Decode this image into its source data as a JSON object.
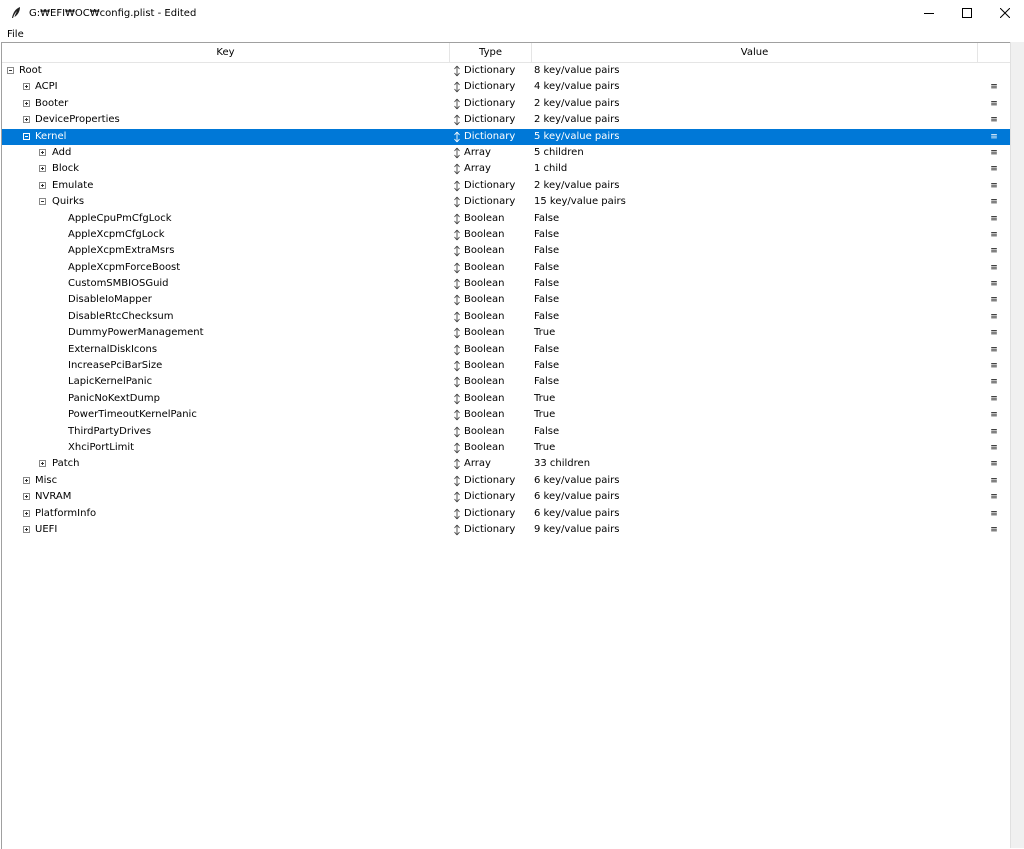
{
  "window": {
    "title": "G:₩EFI₩OC₩config.plist - Edited"
  },
  "menubar": {
    "file_label": "File"
  },
  "columns": {
    "key": "Key",
    "type": "Type",
    "value": "Value"
  },
  "icons": {
    "row_menu_glyph": "≡",
    "expand": "expand-icon",
    "collapse": "collapse-icon"
  },
  "colors": {
    "selection": "#0078d7"
  },
  "tree": [
    {
      "key": "Root",
      "type": "Dictionary",
      "value": "8 key/value pairs",
      "depth": 0,
      "toggle": "collapse",
      "selected": false,
      "menu": false
    },
    {
      "key": "ACPI",
      "type": "Dictionary",
      "value": "4 key/value pairs",
      "depth": 1,
      "toggle": "expand",
      "selected": false,
      "menu": true
    },
    {
      "key": "Booter",
      "type": "Dictionary",
      "value": "2 key/value pairs",
      "depth": 1,
      "toggle": "expand",
      "selected": false,
      "menu": true
    },
    {
      "key": "DeviceProperties",
      "type": "Dictionary",
      "value": "2 key/value pairs",
      "depth": 1,
      "toggle": "expand",
      "selected": false,
      "menu": true
    },
    {
      "key": "Kernel",
      "type": "Dictionary",
      "value": "5 key/value pairs",
      "depth": 1,
      "toggle": "collapse",
      "selected": true,
      "menu": true
    },
    {
      "key": "Add",
      "type": "Array",
      "value": "5 children",
      "depth": 2,
      "toggle": "expand",
      "selected": false,
      "menu": true
    },
    {
      "key": "Block",
      "type": "Array",
      "value": "1 child",
      "depth": 2,
      "toggle": "expand",
      "selected": false,
      "menu": true
    },
    {
      "key": "Emulate",
      "type": "Dictionary",
      "value": "2 key/value pairs",
      "depth": 2,
      "toggle": "expand",
      "selected": false,
      "menu": true
    },
    {
      "key": "Quirks",
      "type": "Dictionary",
      "value": "15 key/value pairs",
      "depth": 2,
      "toggle": "collapse",
      "selected": false,
      "menu": true
    },
    {
      "key": "AppleCpuPmCfgLock",
      "type": "Boolean",
      "value": "False",
      "depth": 3,
      "toggle": "none",
      "selected": false,
      "menu": true
    },
    {
      "key": "AppleXcpmCfgLock",
      "type": "Boolean",
      "value": "False",
      "depth": 3,
      "toggle": "none",
      "selected": false,
      "menu": true
    },
    {
      "key": "AppleXcpmExtraMsrs",
      "type": "Boolean",
      "value": "False",
      "depth": 3,
      "toggle": "none",
      "selected": false,
      "menu": true
    },
    {
      "key": "AppleXcpmForceBoost",
      "type": "Boolean",
      "value": "False",
      "depth": 3,
      "toggle": "none",
      "selected": false,
      "menu": true
    },
    {
      "key": "CustomSMBIOSGuid",
      "type": "Boolean",
      "value": "False",
      "depth": 3,
      "toggle": "none",
      "selected": false,
      "menu": true
    },
    {
      "key": "DisableIoMapper",
      "type": "Boolean",
      "value": "False",
      "depth": 3,
      "toggle": "none",
      "selected": false,
      "menu": true
    },
    {
      "key": "DisableRtcChecksum",
      "type": "Boolean",
      "value": "False",
      "depth": 3,
      "toggle": "none",
      "selected": false,
      "menu": true
    },
    {
      "key": "DummyPowerManagement",
      "type": "Boolean",
      "value": "True",
      "depth": 3,
      "toggle": "none",
      "selected": false,
      "menu": true
    },
    {
      "key": "ExternalDiskIcons",
      "type": "Boolean",
      "value": "False",
      "depth": 3,
      "toggle": "none",
      "selected": false,
      "menu": true
    },
    {
      "key": "IncreasePciBarSize",
      "type": "Boolean",
      "value": "False",
      "depth": 3,
      "toggle": "none",
      "selected": false,
      "menu": true
    },
    {
      "key": "LapicKernelPanic",
      "type": "Boolean",
      "value": "False",
      "depth": 3,
      "toggle": "none",
      "selected": false,
      "menu": true
    },
    {
      "key": "PanicNoKextDump",
      "type": "Boolean",
      "value": "True",
      "depth": 3,
      "toggle": "none",
      "selected": false,
      "menu": true
    },
    {
      "key": "PowerTimeoutKernelPanic",
      "type": "Boolean",
      "value": "True",
      "depth": 3,
      "toggle": "none",
      "selected": false,
      "menu": true
    },
    {
      "key": "ThirdPartyDrives",
      "type": "Boolean",
      "value": "False",
      "depth": 3,
      "toggle": "none",
      "selected": false,
      "menu": true
    },
    {
      "key": "XhciPortLimit",
      "type": "Boolean",
      "value": "True",
      "depth": 3,
      "toggle": "none",
      "selected": false,
      "menu": true
    },
    {
      "key": "Patch",
      "type": "Array",
      "value": "33 children",
      "depth": 2,
      "toggle": "expand",
      "selected": false,
      "menu": true
    },
    {
      "key": "Misc",
      "type": "Dictionary",
      "value": "6 key/value pairs",
      "depth": 1,
      "toggle": "expand",
      "selected": false,
      "menu": true
    },
    {
      "key": "NVRAM",
      "type": "Dictionary",
      "value": "6 key/value pairs",
      "depth": 1,
      "toggle": "expand",
      "selected": false,
      "menu": true
    },
    {
      "key": "PlatformInfo",
      "type": "Dictionary",
      "value": "6 key/value pairs",
      "depth": 1,
      "toggle": "expand",
      "selected": false,
      "menu": true
    },
    {
      "key": "UEFI",
      "type": "Dictionary",
      "value": "9 key/value pairs",
      "depth": 1,
      "toggle": "expand",
      "selected": false,
      "menu": true
    }
  ]
}
